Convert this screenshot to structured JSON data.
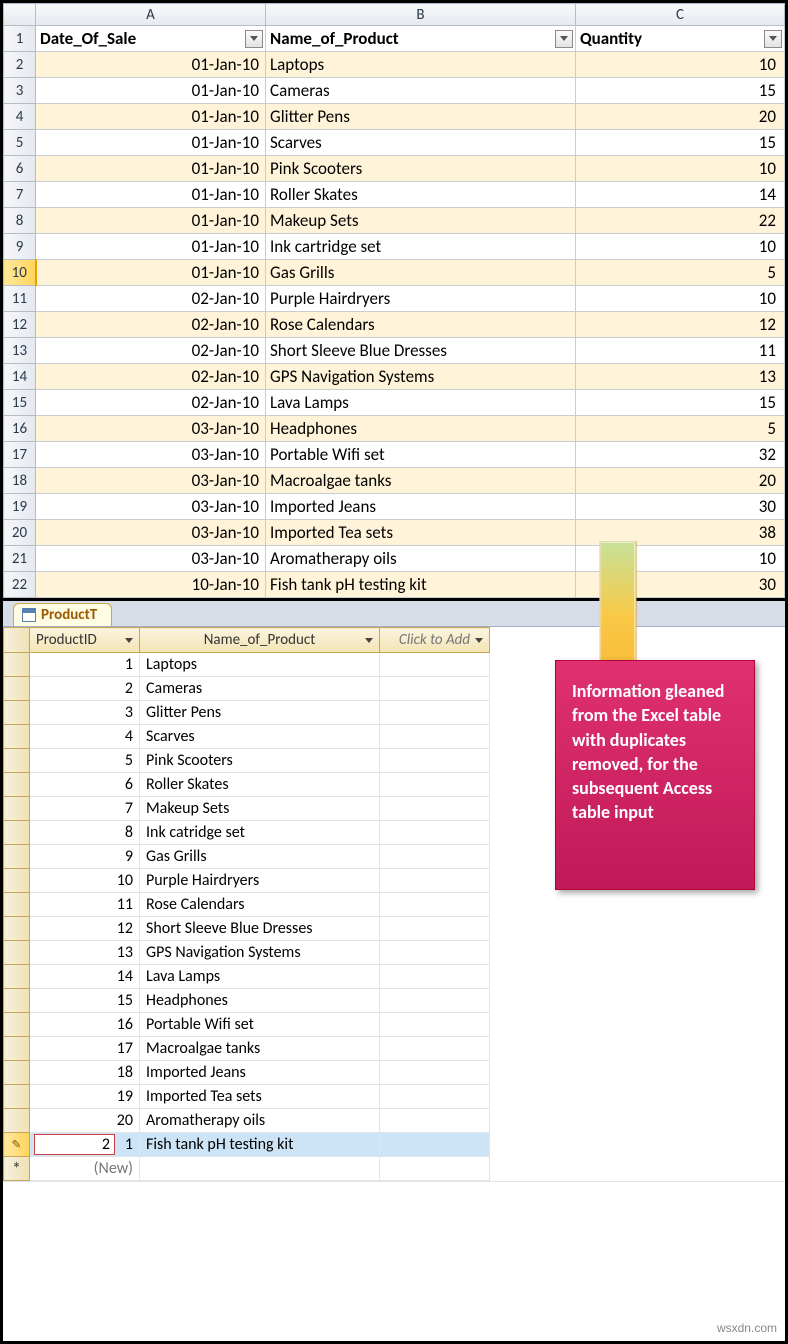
{
  "excel": {
    "col_headers": [
      "A",
      "B",
      "C"
    ],
    "header": {
      "date": "Date_Of_Sale",
      "name": "Name_of_Product",
      "qty": "Quantity"
    },
    "selected_row_num": 10,
    "rows": [
      {
        "n": 2,
        "date": "01-Jan-10",
        "name": "Laptops",
        "qty": "10",
        "band": true
      },
      {
        "n": 3,
        "date": "01-Jan-10",
        "name": "Cameras",
        "qty": "15",
        "band": false
      },
      {
        "n": 4,
        "date": "01-Jan-10",
        "name": "Glitter Pens",
        "qty": "20",
        "band": true
      },
      {
        "n": 5,
        "date": "01-Jan-10",
        "name": "Scarves",
        "qty": "15",
        "band": false
      },
      {
        "n": 6,
        "date": "01-Jan-10",
        "name": "Pink Scooters",
        "qty": "10",
        "band": true
      },
      {
        "n": 7,
        "date": "01-Jan-10",
        "name": "Roller Skates",
        "qty": "14",
        "band": false
      },
      {
        "n": 8,
        "date": "01-Jan-10",
        "name": "Makeup Sets",
        "qty": "22",
        "band": true
      },
      {
        "n": 9,
        "date": "01-Jan-10",
        "name": "Ink cartridge set",
        "qty": "10",
        "band": false
      },
      {
        "n": 10,
        "date": "01-Jan-10",
        "name": "Gas Grills",
        "qty": "5",
        "band": true
      },
      {
        "n": 11,
        "date": "02-Jan-10",
        "name": "Purple Hairdryers",
        "qty": "10",
        "band": false
      },
      {
        "n": 12,
        "date": "02-Jan-10",
        "name": "Rose Calendars",
        "qty": "12",
        "band": true
      },
      {
        "n": 13,
        "date": "02-Jan-10",
        "name": "Short Sleeve Blue Dresses",
        "qty": "11",
        "band": false
      },
      {
        "n": 14,
        "date": "02-Jan-10",
        "name": "GPS Navigation Systems",
        "qty": "13",
        "band": true
      },
      {
        "n": 15,
        "date": "02-Jan-10",
        "name": "Lava Lamps",
        "qty": "15",
        "band": false
      },
      {
        "n": 16,
        "date": "03-Jan-10",
        "name": "Headphones",
        "qty": "5",
        "band": true
      },
      {
        "n": 17,
        "date": "03-Jan-10",
        "name": "Portable Wifi set",
        "qty": "32",
        "band": false
      },
      {
        "n": 18,
        "date": "03-Jan-10",
        "name": "Macroalgae tanks",
        "qty": "20",
        "band": true
      },
      {
        "n": 19,
        "date": "03-Jan-10",
        "name": "Imported Jeans",
        "qty": "30",
        "band": false
      },
      {
        "n": 20,
        "date": "03-Jan-10",
        "name": "Imported Tea sets",
        "qty": "38",
        "band": true
      },
      {
        "n": 21,
        "date": "03-Jan-10",
        "name": "Aromatherapy oils",
        "qty": "10",
        "band": false
      },
      {
        "n": 22,
        "date": "10-Jan-10",
        "name": "Fish tank pH testing kit",
        "qty": "30",
        "band": true
      }
    ]
  },
  "access": {
    "tab_label": "ProductT",
    "headers": {
      "id": "ProductID",
      "name": "Name_of_Product",
      "add": "Click to Add"
    },
    "new_row_label": "(New)",
    "editing_id_prefix": "2",
    "rows": [
      {
        "id": "1",
        "name": "Laptops"
      },
      {
        "id": "2",
        "name": "Cameras"
      },
      {
        "id": "3",
        "name": "Glitter Pens"
      },
      {
        "id": "4",
        "name": "Scarves"
      },
      {
        "id": "5",
        "name": "Pink Scooters"
      },
      {
        "id": "6",
        "name": "Roller Skates"
      },
      {
        "id": "7",
        "name": "Makeup Sets"
      },
      {
        "id": "8",
        "name": "Ink catridge set"
      },
      {
        "id": "9",
        "name": "Gas Grills"
      },
      {
        "id": "10",
        "name": "Purple Hairdryers"
      },
      {
        "id": "11",
        "name": "Rose Calendars"
      },
      {
        "id": "12",
        "name": "Short Sleeve Blue Dresses"
      },
      {
        "id": "13",
        "name": "GPS Navigation Systems"
      },
      {
        "id": "14",
        "name": "Lava Lamps"
      },
      {
        "id": "15",
        "name": "Headphones"
      },
      {
        "id": "16",
        "name": "Portable Wifi set"
      },
      {
        "id": "17",
        "name": "Macroalgae tanks"
      },
      {
        "id": "18",
        "name": "Imported Jeans"
      },
      {
        "id": "19",
        "name": "Imported Tea sets"
      },
      {
        "id": "20",
        "name": "Aromatherapy oils"
      },
      {
        "id": "21",
        "name": "Fish tank pH testing kit",
        "editing": true
      }
    ]
  },
  "callout_text": "Information gleaned from the Excel table with duplicates removed, for the subsequent Access table input",
  "watermark": "wsxdn.com"
}
